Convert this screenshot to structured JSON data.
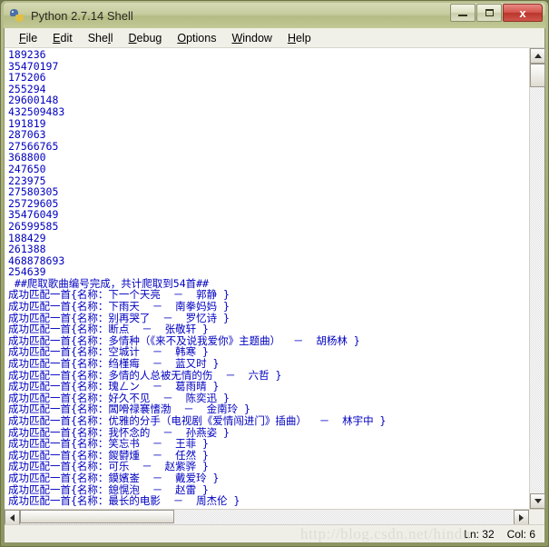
{
  "window": {
    "title": "Python 2.7.14 Shell",
    "app_icon": "python-icon",
    "minimize_label": "Minimize",
    "maximize_label": "Maximize",
    "close_label": "x"
  },
  "menubar": {
    "items": [
      {
        "label": "File",
        "accel": "F"
      },
      {
        "label": "Edit",
        "accel": "E"
      },
      {
        "label": "Shell",
        "accel": "l"
      },
      {
        "label": "Debug",
        "accel": "D"
      },
      {
        "label": "Options",
        "accel": "O"
      },
      {
        "label": "Window",
        "accel": "W"
      },
      {
        "label": "Help",
        "accel": "H"
      }
    ]
  },
  "console": {
    "text_color": "#0000c0",
    "background": "#ffffff",
    "lines": [
      "189236",
      "35470197",
      "175206",
      "255294",
      "29600148",
      "432509483",
      "191819",
      "287063",
      "27566765",
      "368800",
      "247650",
      "223975",
      "27580305",
      "25729605",
      "35476049",
      "26599585",
      "188429",
      "261388",
      "468878693",
      "254639",
      " ##爬取歌曲编号完成，共计爬取到54首##",
      "成功匹配一首{名称：下一个天亮  －  郭静 }",
      "成功匹配一首{名称：下雨天  －  南拳妈妈 }",
      "成功匹配一首{名称：别再哭了  －  罗忆诗 }",
      "成功匹配一首{名称：断点  －  张敬轩 }",
      "成功匹配一首{名称：多情种（《来不及说我爱你》主题曲）  －  胡杨林 }",
      "成功匹配一首{名称：空城计  －  韩寒 }",
      "成功匹配一首{名称：绉槿痗  －  蓝又时 }",
      "成功匹配一首{名称：多情的人总被无情的伤  －  六哲 }",
      "成功匹配一首{名称：瑰ㄥン  －  葛雨晴 }",
      "成功匹配一首{名称：好久不见  －  陈奕迅 }",
      "成功匹配一首{名称：闆嗗禄褰愭渤  －  金南玲 }",
      "成功匹配一首{名称：优雅的分手（电视剧《爱情闯进门》插曲）  －  林宇中 }",
      "成功匹配一首{名称：我怀念的  －  孙燕姿 }",
      "成功匹配一首{名称：笑忘书  －  王菲 }",
      "成功匹配一首{名称：鍐欎煄  －  任然 }",
      "成功匹配一首{名称：可乐  －  赵紫骅 }",
      "成功匹配一首{名称：鏌嬪崟  －  戴爱玲 }",
      "成功匹配一首{名称：鎴愰泡  －  赵雷 }",
      "成功匹配一首{名称：最长的电影  －  周杰伦 }"
    ]
  },
  "scrollbars": {
    "v_up_icon": "triangle-up-icon",
    "v_down_icon": "triangle-down-icon",
    "h_left_icon": "triangle-left-icon",
    "h_right_icon": "triangle-right-icon"
  },
  "statusbar": {
    "line_label": "Ln: 32",
    "col_label": "Col: 6",
    "watermark": "http://blog.csdn.net/hindu"
  }
}
